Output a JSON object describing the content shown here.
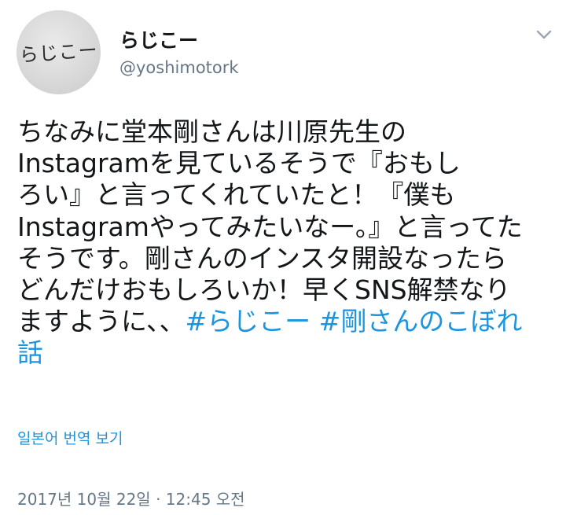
{
  "author": {
    "avatar_text": "らじこー",
    "display_name": "らじこー",
    "handle": "@yoshimotork"
  },
  "menu": {
    "icon": "chevron-down-icon"
  },
  "tweet": {
    "text_lines": [
      "ちなみに堂本剛さんは川原先生の",
      "Instagramを見ているそうで『おもし",
      "ろい』と言ってくれていたと！『僕も",
      "Instagramやってみたいなー。』と言ってた",
      "そうです。剛さんのインスタ開設なったら",
      "どんだけおもしろいか！早くSNS解禁なり"
    ],
    "line7_text": "ますように、、",
    "hashtag_1": "#らじこー",
    "hashtag_2": "#剛さんのこぼれ",
    "hashtag_2_cont": "話",
    "hashtag_color": "#1b95e0"
  },
  "translate_label": "일본어 번역 보기",
  "timestamp": "2017년 10월 22일 · 12:45 오전"
}
